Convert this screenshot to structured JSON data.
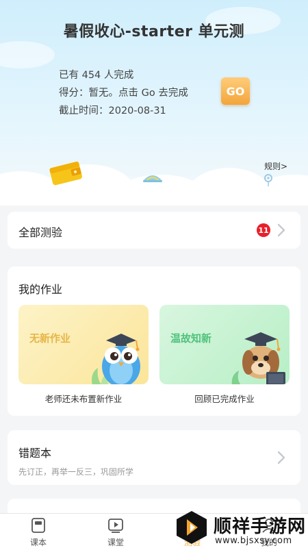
{
  "hero": {
    "title": "暑假收心-starter 单元测",
    "completed": "已有 454 人完成",
    "score": "得分：暂无。点击 Go 去完成",
    "deadline": "截止时间：2020-08-31",
    "go_label": "GO",
    "rules_label": "规则>"
  },
  "all_tests": {
    "label": "全部测验",
    "badge": "11"
  },
  "homework": {
    "label": "我的作业",
    "tiles": [
      {
        "title": "无新作业",
        "caption": "老师还未布置新作业"
      },
      {
        "title": "温故知新",
        "caption": "回顾已完成作业"
      }
    ]
  },
  "wrong_book": {
    "label": "错题本",
    "sub": "先订正，再举一反三，巩固所学"
  },
  "tabs": [
    {
      "label": "课本",
      "icon": "book-icon"
    },
    {
      "label": "课堂",
      "icon": "video-icon"
    },
    {
      "label": "测验",
      "icon": "quiz-icon",
      "active": true
    },
    {
      "label": "我的",
      "icon": "profile-icon"
    }
  ],
  "watermark": {
    "text": "顺祥手游网",
    "url": "www.bjsxsy.com"
  },
  "colors": {
    "accent": "#f2a531",
    "badge": "#e8202a",
    "go": "#f3a53b"
  }
}
